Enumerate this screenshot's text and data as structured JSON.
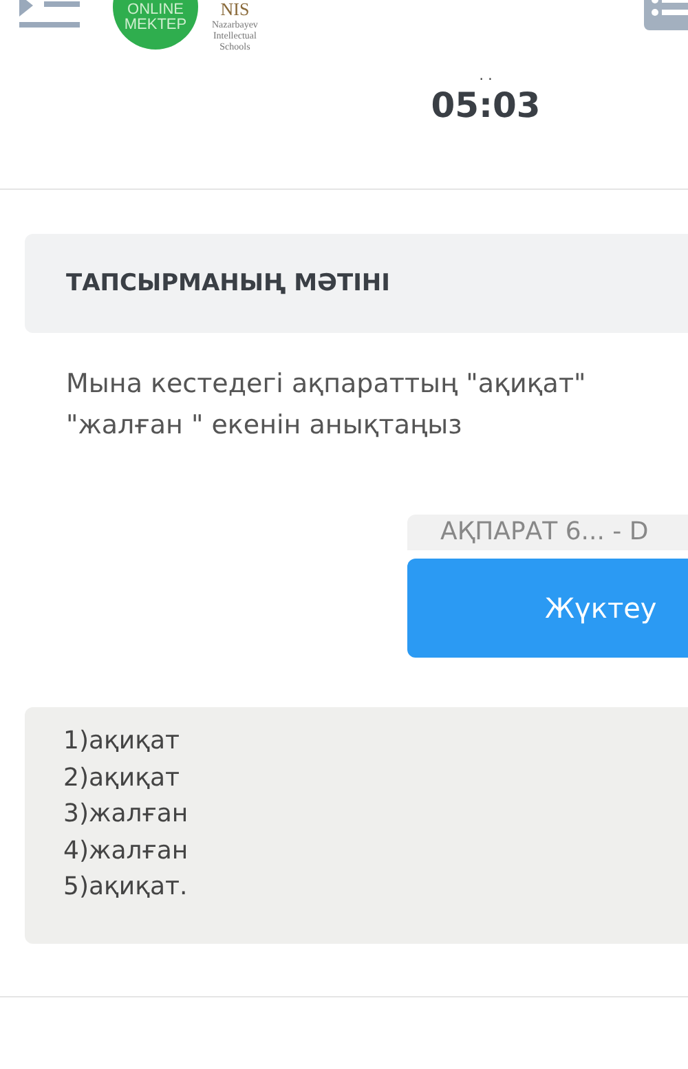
{
  "header": {
    "logo_top": "ONLINE",
    "logo_bottom": "MEKTEP",
    "nis_mark": "NIS",
    "nis_lines": [
      "Nazarbayev",
      "Intellectual",
      "Schools"
    ]
  },
  "timer": {
    "dots": ". .",
    "time": "05:03"
  },
  "task": {
    "title": "ТАПСЫРМАНЫҢ МӘТІНІ",
    "question_lines": [
      "Мына кестедегі ақпараттың \"ақиқат\"",
      "\"жалған \" екенін анықтаңыз"
    ]
  },
  "attachment": {
    "file_name": "АҚПАРАТ 6... - D",
    "button": "Жүктеу"
  },
  "answer": {
    "lines": [
      "1)ақиқат",
      "2)ақиқат",
      "3)жалған",
      "4)жалған",
      "5)ақиқат."
    ]
  }
}
